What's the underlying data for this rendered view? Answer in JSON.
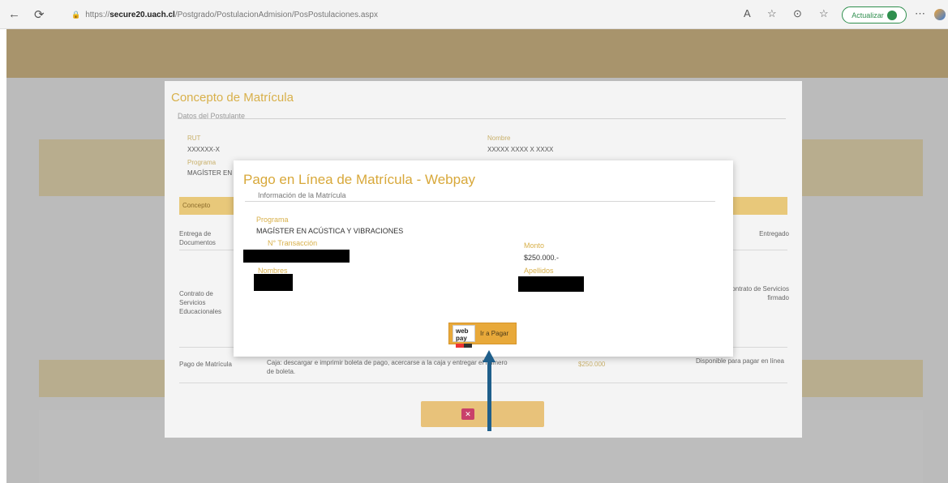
{
  "browser": {
    "url_prefix": "https://",
    "url_host": "secure20.uach.cl",
    "url_path": "/Postgrado/PostulacionAdmision/PosPostulaciones.aspx",
    "update_label": "Actualizar",
    "back_glyph": "←",
    "refresh_glyph": "⟳",
    "lock_glyph": "🔒",
    "read_aloud_glyph": "A",
    "favorite_glyph": "☆",
    "extensions_glyph": "⊙",
    "collections_glyph": "☆",
    "more_glyph": "⋯"
  },
  "background_modal": {
    "title": "Concepto de Matrícula",
    "legend": "Datos del Postulante",
    "fields": {
      "rut_label": "RUT",
      "rut_value": "XXXXXX-X",
      "nombre_label": "Nombre",
      "nombre_value": "XXXXX XXXX X XXXX",
      "programa_label": "Programa",
      "programa_value": "MAGÍSTER EN"
    },
    "table_header": "Concepto",
    "rows": [
      {
        "concept": "Entrega de Documentos",
        "status": "Entregado"
      },
      {
        "concept": "Contrato de Servicios Educacionales",
        "status": "Contrato de Servicios firmado"
      },
      {
        "concept": "Pago de Matrícula",
        "description": "Caja: descargar e imprimir boleta de pago, acercarse a la caja y entregar el número de boleta.",
        "amount": "$250.000",
        "status": "Disponible para pagar en línea"
      }
    ],
    "close_glyph": "✕"
  },
  "webpay_modal": {
    "title": "Pago en Línea de Matrícula - Webpay",
    "legend": "Información de la Matrícula",
    "programa_label": "Programa",
    "programa_value": "MAGÍSTER EN ACÚSTICA Y VIBRACIONES",
    "transaccion_label": "N° Transacción",
    "monto_label": "Monto",
    "monto_value": "$250.000.-",
    "nombres_label": "Nombres",
    "apellidos_label": "Apellidos",
    "pay_button_label": "Ir a Pagar",
    "webpay_logo_text": "web pay"
  },
  "colors": {
    "accent_gold": "#d8a83a",
    "header_gold": "#c9a45c",
    "arrow_blue": "#1f5f8b"
  }
}
